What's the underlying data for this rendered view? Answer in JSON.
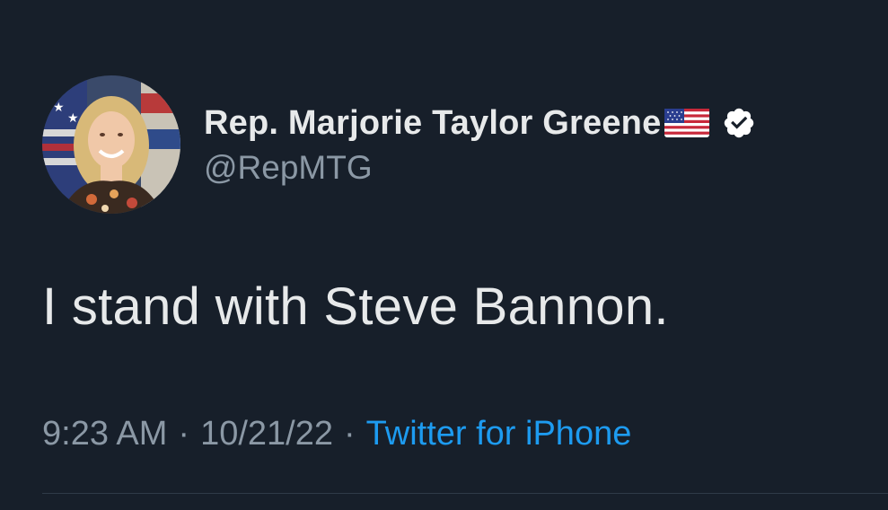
{
  "tweet": {
    "author": {
      "display_name": "Rep. Marjorie Taylor Greene",
      "flag_emoji": "flag-us-icon",
      "verified_icon": "verified-badge-icon",
      "handle": "@RepMTG"
    },
    "text": "I stand with Steve Bannon.",
    "meta": {
      "time": "9:23 AM",
      "separator_1": "·",
      "date": "10/21/22",
      "separator_2": "·",
      "source": "Twitter for iPhone"
    }
  },
  "colors": {
    "background": "#171f2a",
    "primary_text": "#e7e9ea",
    "secondary_text": "#8b98a5",
    "link": "#1d9bf0"
  }
}
